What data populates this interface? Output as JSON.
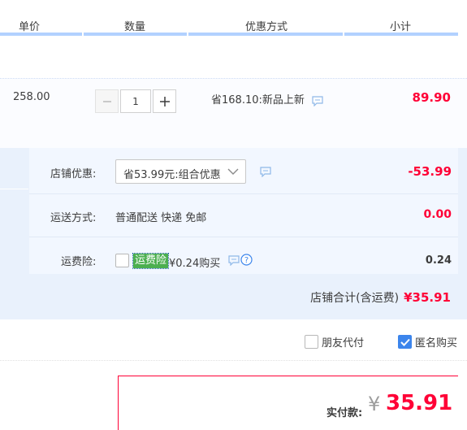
{
  "header": {
    "col_unit_price": "单价",
    "col_quantity": "数量",
    "col_promo": "优惠方式",
    "col_subtotal": "小计"
  },
  "item": {
    "unit_price": "258.00",
    "quantity": "1",
    "promo_text": "省168.10:新品上新",
    "subtotal": "89.90"
  },
  "shop": {
    "discount_label": "店铺优惠:",
    "discount_select_value": "省53.99元:组合优惠",
    "discount_amount": "-53.99",
    "shipping_label": "运送方式:",
    "shipping_value": "普通配送 快递 免邮",
    "shipping_amount": "0.00",
    "insurance_label": "运费险:",
    "insurance_tag": "运费险",
    "insurance_price": "¥0.24购买",
    "insurance_amount": "0.24",
    "total_label": "店铺合计(含运费)",
    "total_amount": "¥35.91"
  },
  "options": {
    "friend_pay_label": "朋友代付",
    "friend_pay_checked": false,
    "anonymous_label": "匿名购买",
    "anonymous_checked": true
  },
  "payment": {
    "label": "实付款:",
    "currency": "¥",
    "amount": "35.91"
  },
  "colors": {
    "accent_red": "#ff0036",
    "header_bar": "#b2d1ff",
    "section_bg": "#e9f1fc",
    "checkbox_blue": "#3c85ec",
    "tag_green": "#4caf50"
  },
  "icons": {
    "minus": "minus-icon",
    "plus": "plus-icon",
    "chat": "chat-bubble-icon",
    "chevron": "chevron-down-icon",
    "help": "help-circle-icon",
    "check": "checkmark-icon"
  }
}
